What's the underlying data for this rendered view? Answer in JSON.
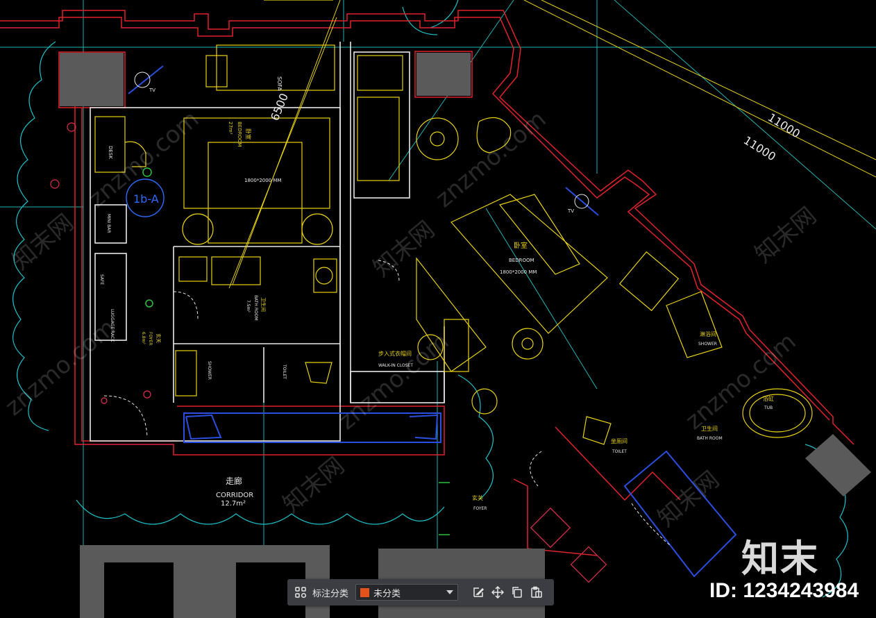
{
  "drawing": {
    "labels": {
      "dim_6500": "6500",
      "dim_11000_a": "11000",
      "dim_11000_b": "11000",
      "sofa": "SOFA",
      "tv_left": "TV",
      "tv_right": "TV",
      "bed_left_cn": "卧室",
      "bed_left_en": "BEDROOM",
      "bed_left_area": "27m²",
      "bed_left_size": "1800*2000 MM",
      "tag_1b": "1b-A",
      "desk": "DESK",
      "minibar": "MINI BAR",
      "safe": "SAFE",
      "luggage": "LUGGAGE RACK",
      "foyer_cn": "玄关",
      "foyer_en": "FOYER",
      "foyer_area": "6.8m²",
      "bath_cn": "卫生间",
      "bath_en": "BATH ROOM",
      "bath_area": "7.5m²",
      "shower_left": "SHOWER",
      "toilet_left": "TOILET",
      "corridor_cn": "走廊",
      "corridor_en": "CORRIDOR",
      "corridor_area": "12.7m²",
      "closet_cn": "步入式衣帽间",
      "closet_en": "WALK-IN CLOSET",
      "bed_right_cn": "卧室",
      "bed_right_en": "BEDROOM",
      "bed_right_size": "1800*2000 MM",
      "shower_right_cn": "淋浴间",
      "shower_right_en": "SHOWER",
      "tub_cn": "浴缸",
      "tub_en": "TUB",
      "bath_right_cn": "卫生间",
      "bath_right_en": "BATH ROOM",
      "toilet_right_cn": "坐厕间",
      "toilet_right_en": "TOILET",
      "foyer_right_cn": "玄关",
      "foyer_right_en": "FOYER"
    },
    "watermark_text": "znzmo.com",
    "watermark_cn": "知末网"
  },
  "toolbar": {
    "grid_icon": "grid-icon",
    "label": "标注分类",
    "category_value": "未分类",
    "category_color": "#e2531b",
    "edit_icon": "edit-icon",
    "move_icon": "move-icon",
    "copy_icon": "copy-icon",
    "paste_icon": "paste-icon"
  },
  "brand": {
    "logo_text": "知末",
    "id_text": "ID: 1234243984"
  }
}
